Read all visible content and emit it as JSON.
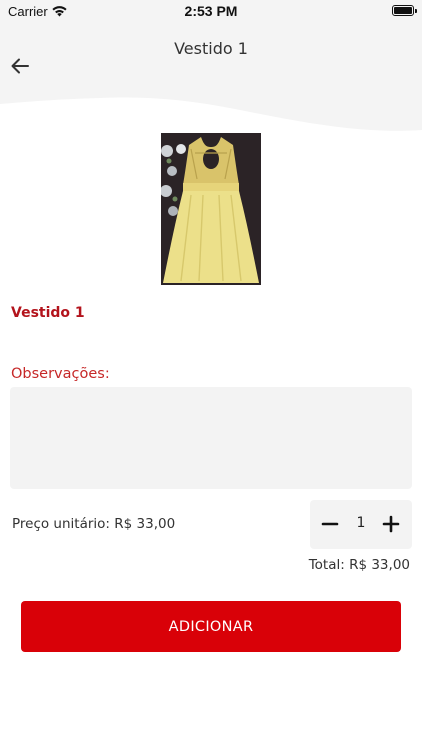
{
  "status_bar": {
    "carrier": "Carrier",
    "time": "2:53 PM",
    "wifi_icon": "wifi-icon",
    "battery_icon": "battery-icon"
  },
  "header": {
    "title": "Vestido 1",
    "back_icon": "arrow-left-icon"
  },
  "product": {
    "name": "Vestido 1",
    "image_description": "yellow-dress-photo"
  },
  "observations": {
    "label": "Observações:",
    "value": "",
    "placeholder": ""
  },
  "pricing": {
    "unit_price_text": "Preço unitário: R$ 33,00",
    "quantity": "1",
    "total_text": "Total: R$ 33,00"
  },
  "actions": {
    "add_label": "ADICIONAR"
  },
  "colors": {
    "accent": "#d90108",
    "title_red": "#b3131c",
    "field_bg": "#f3f3f3",
    "header_bg": "#f4f4f4"
  }
}
